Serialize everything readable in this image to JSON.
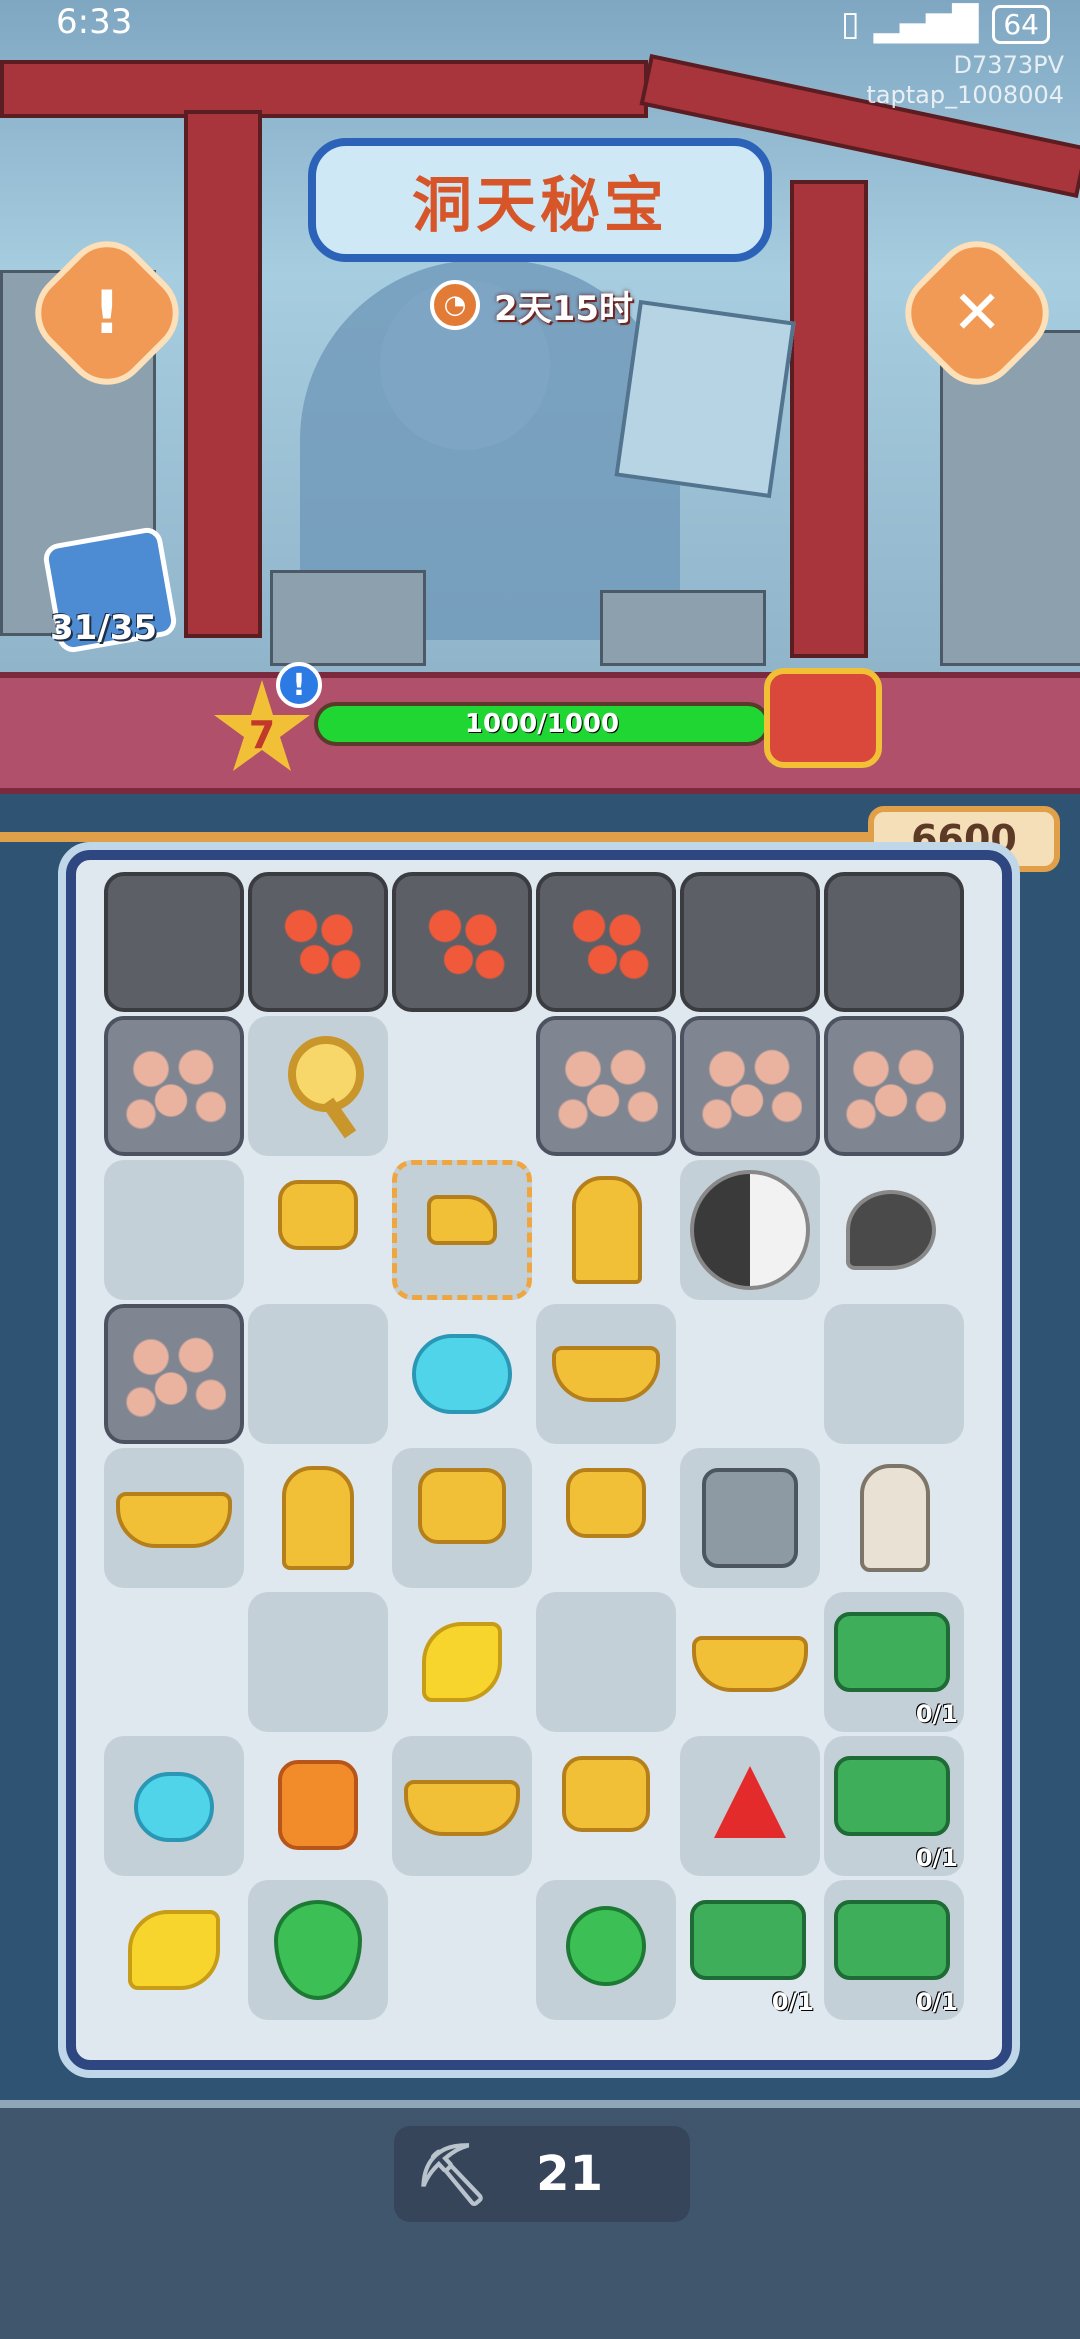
{
  "status_bar": {
    "time": "6:33",
    "battery": "64"
  },
  "watermark": {
    "line1": "D7373PV",
    "line2": "taptap_1008004"
  },
  "header": {
    "title": "洞天秘宝",
    "timer": "2天15时",
    "info_button": "!",
    "close_button": "✕"
  },
  "collection": {
    "label": "31/35"
  },
  "level": {
    "number": "7",
    "notice": "!"
  },
  "progress": {
    "text": "1000/1000",
    "value": 1.0
  },
  "score": {
    "value": "6600"
  },
  "board": {
    "badge_green_chest_1": "0/1",
    "badge_green_chest_2": "0/1",
    "badge_green_chest_3": "0/1",
    "badge_green_chest_4": "0/1"
  },
  "pickaxe": {
    "count": "21"
  },
  "colors": {
    "progress_fill": "#20d633",
    "board_frame": "#2f4780",
    "accent": "#f19a56"
  }
}
